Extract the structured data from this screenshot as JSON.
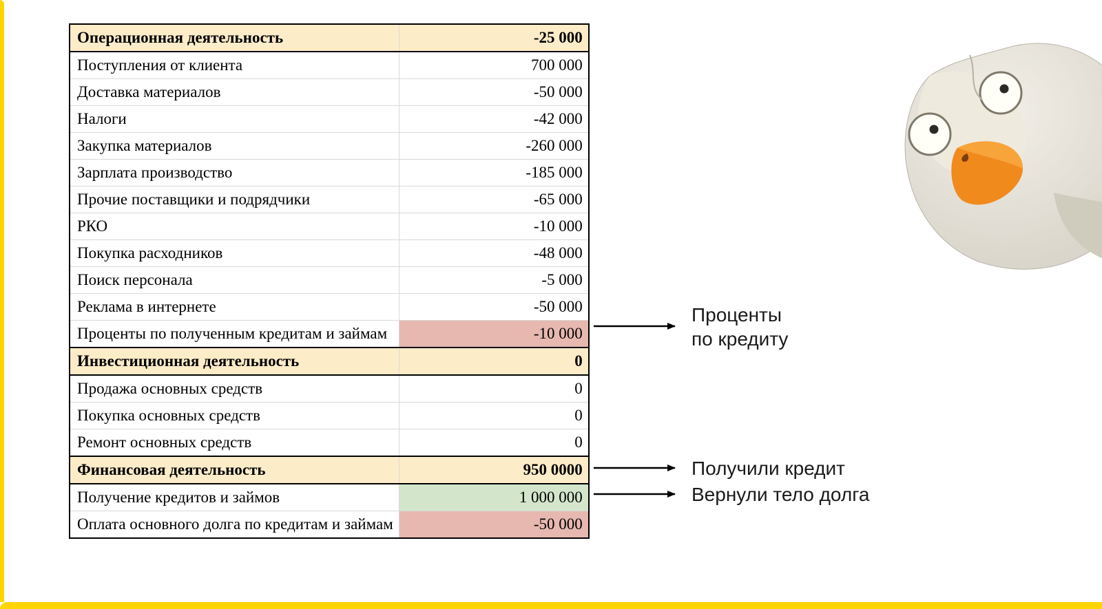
{
  "colors": {
    "section_bg": "#fdecc8",
    "highlight_red": "#e7b8b0",
    "highlight_green": "#d3e6cb",
    "accent_yellow": "#ffd400"
  },
  "table": {
    "sections": [
      {
        "title": "Операционная деятельность",
        "total": "-25 000",
        "rows": [
          {
            "label": "Поступления от клиента",
            "value": "700 000"
          },
          {
            "label": "Доставка материалов",
            "value": "-50 000"
          },
          {
            "label": "Налоги",
            "value": "-42 000"
          },
          {
            "label": "Закупка материалов",
            "value": "-260 000"
          },
          {
            "label": "Зарплата производство",
            "value": "-185 000"
          },
          {
            "label": "Прочие поставщики и подрядчики",
            "value": "-65 000"
          },
          {
            "label": "РКО",
            "value": "-10 000"
          },
          {
            "label": "Покупка расходников",
            "value": "-48 000"
          },
          {
            "label": "Поиск персонала",
            "value": "-5 000"
          },
          {
            "label": "Реклама в интернете",
            "value": "-50 000"
          },
          {
            "label": "Проценты по полученным кредитам и займам",
            "value": "-10 000",
            "value_highlight": "red"
          }
        ]
      },
      {
        "title": "Инвестиционная деятельность",
        "total": "0",
        "rows": [
          {
            "label": "Продажа основных средств",
            "value": "0"
          },
          {
            "label": "Покупка основных средств",
            "value": "0"
          },
          {
            "label": "Ремонт основных средств",
            "value": "0"
          }
        ]
      },
      {
        "title": "Финансовая деятельность",
        "total": "950 0000",
        "rows": [
          {
            "label": "Получение кредитов и займов",
            "value": "1 000 000",
            "value_highlight": "green"
          },
          {
            "label": "Оплата основного долга по кредитам и займам",
            "value": "-50 000",
            "value_highlight": "red"
          }
        ]
      }
    ]
  },
  "annotations": [
    {
      "id": "interest",
      "text_lines": [
        "Проценты",
        "по кредиту"
      ]
    },
    {
      "id": "got-loan",
      "text_lines": [
        "Получили кредит"
      ]
    },
    {
      "id": "paid-body",
      "text_lines": [
        "Вернули тело долга"
      ]
    }
  ]
}
